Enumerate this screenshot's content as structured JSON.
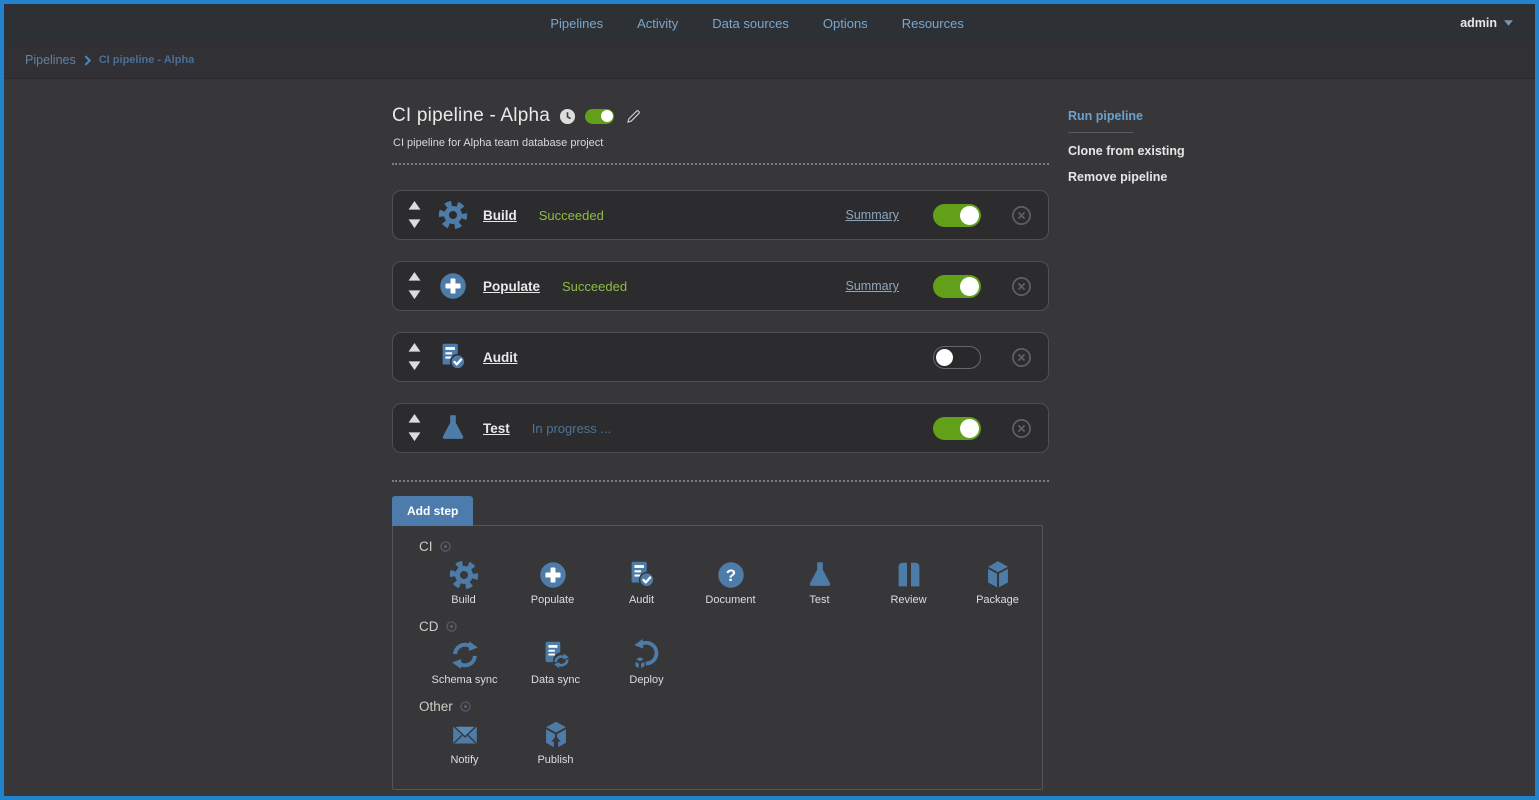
{
  "nav": {
    "items": [
      "Pipelines",
      "Activity",
      "Data sources",
      "Options",
      "Resources"
    ],
    "user": "admin"
  },
  "breadcrumb": {
    "root": "Pipelines",
    "current": "CI pipeline - Alpha"
  },
  "header": {
    "title": "CI pipeline - Alpha",
    "description": "CI pipeline for Alpha team database project",
    "enabled": true,
    "icons": [
      "clock-icon",
      "enabled-toggle",
      "edit-pencil-icon"
    ]
  },
  "side_actions": {
    "run": "Run pipeline",
    "clone": "Clone from existing",
    "remove": "Remove pipeline"
  },
  "steps": [
    {
      "name": "Build",
      "icon": "gear-icon",
      "status": "Succeeded",
      "summary": "Summary",
      "enabled": true
    },
    {
      "name": "Populate",
      "icon": "plus-circle-icon",
      "status": "Succeeded",
      "summary": "Summary",
      "enabled": true
    },
    {
      "name": "Audit",
      "icon": "audit-check-icon",
      "status": "",
      "summary": "",
      "enabled": false
    },
    {
      "name": "Test",
      "icon": "flask-icon",
      "status": "In progress ...",
      "summary": "",
      "enabled": true
    }
  ],
  "add_step": {
    "tab": "Add step",
    "groups": [
      {
        "label": "CI",
        "items": [
          {
            "label": "Build",
            "icon": "gear-icon"
          },
          {
            "label": "Populate",
            "icon": "plus-circle-icon"
          },
          {
            "label": "Audit",
            "icon": "audit-check-icon"
          },
          {
            "label": "Document",
            "icon": "question-circle-icon"
          },
          {
            "label": "Test",
            "icon": "flask-icon"
          },
          {
            "label": "Review",
            "icon": "book-icon"
          },
          {
            "label": "Package",
            "icon": "cube-icon"
          }
        ]
      },
      {
        "label": "CD",
        "items": [
          {
            "label": "Schema sync",
            "icon": "sync-arrows-icon"
          },
          {
            "label": "Data sync",
            "icon": "document-sync-icon"
          },
          {
            "label": "Deploy",
            "icon": "deploy-cube-icon"
          }
        ]
      },
      {
        "label": "Other",
        "items": [
          {
            "label": "Notify",
            "icon": "envelope-icon"
          },
          {
            "label": "Publish",
            "icon": "publish-box-icon"
          }
        ]
      }
    ]
  },
  "colors": {
    "window_accent": "#2283cc",
    "icon_blue": "#4d7ca9",
    "success_green": "#8cbe41",
    "toggle_green": "#61a018",
    "nav_link_blue": "#7ba6cd",
    "progress_blue": "#4f7396"
  }
}
